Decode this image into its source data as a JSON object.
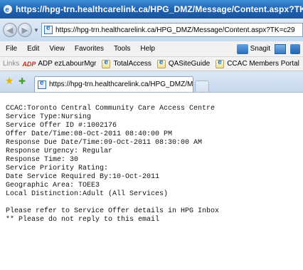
{
  "window": {
    "title": "https://hpg-trn.healthcarelink.ca/HPG_DMZ/Message/Content.aspx?TK=c29"
  },
  "address_bar": {
    "url": "https://hpg-trn.healthcarelink.ca/HPG_DMZ/Message/Content.aspx?TK=c29"
  },
  "menu": {
    "items": [
      "File",
      "Edit",
      "View",
      "Favorites",
      "Tools",
      "Help"
    ],
    "snagit_label": "Snagit"
  },
  "links_bar": {
    "label": "Links",
    "items": [
      "ADP ezLabourMgr",
      "TotalAccess",
      "QASiteGuide",
      "CCAC Members Portal"
    ]
  },
  "tab": {
    "title": "https://hpg-trn.healthcarelink.ca/HPG_DMZ/Message/..."
  },
  "message": {
    "lines": [
      "CCAC:Toronto Central Community Care Access Centre",
      "Service Type:Nursing",
      "Service Offer ID #:1002176",
      "Offer Date/Time:08-Oct-2011 08:40:00 PM",
      "Response Due Date/Time:09-Oct-2011 08:30:00 AM",
      "Response Urgency: Regular",
      "Response Time: 30",
      "Service Priority Rating:",
      "Date Service Required By:10-Oct-2011",
      "Geographic Area: TOEE3",
      "Local Distinction:Adult (All Services)"
    ],
    "footer_lines": [
      "Please refer to Service Offer details in HPG Inbox",
      "** Please do not reply to this email"
    ]
  }
}
